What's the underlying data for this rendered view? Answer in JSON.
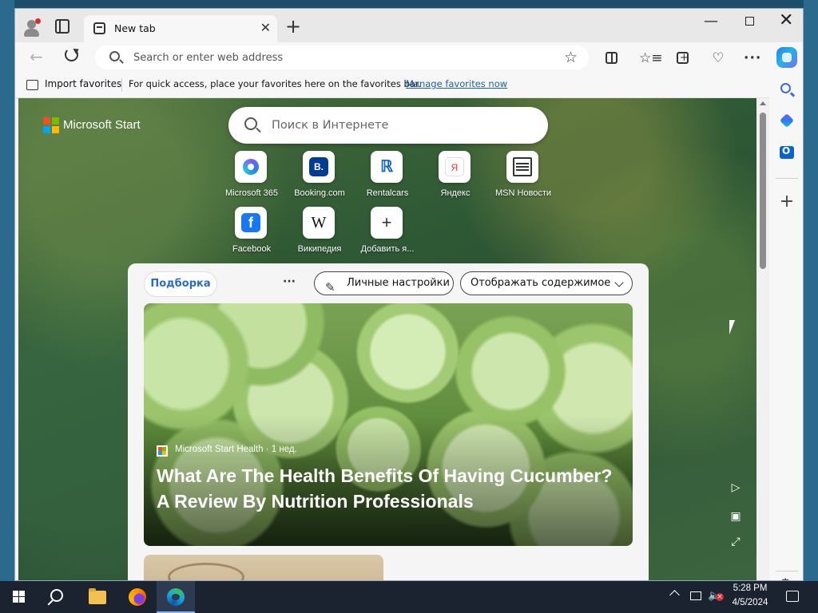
{
  "browser": {
    "tab_title": "New tab",
    "tab_close": "✕",
    "new_tab": "+",
    "address_placeholder": "Search or enter web address",
    "star": "☆",
    "more": "···",
    "favorites_icon": "☆≡",
    "health_icon": "♡"
  },
  "window": {
    "minimize": "—",
    "close": "✕"
  },
  "favbar": {
    "import_label": "Import favorites",
    "tip": "For quick access, place your favorites here on the favorites bar.",
    "manage_link": "Manage favorites now"
  },
  "sidebar": {
    "add": "+",
    "settings": "⚙"
  },
  "newtab": {
    "brand": "Microsoft Start",
    "search_placeholder": "Поиск в Интернете",
    "quick_links": [
      {
        "label": "Microsoft 365",
        "glyph": ""
      },
      {
        "label": "Booking.com",
        "glyph": "B."
      },
      {
        "label": "Rentalcars",
        "glyph": "ℝ"
      },
      {
        "label": "Яндекс",
        "glyph": "Я"
      },
      {
        "label": "MSN Новости",
        "glyph": ""
      },
      {
        "label": "Facebook",
        "glyph": "f"
      },
      {
        "label": "Википедия",
        "glyph": "W"
      },
      {
        "label": "Добавить я...",
        "glyph": "+"
      }
    ]
  },
  "feed": {
    "tab_label": "Подборка",
    "more": "···",
    "personalize_icon": "✎",
    "personalize_label": "Личные настройки",
    "display_label": "Отображать содержимое",
    "hero": {
      "source": "Microsoft Start Health · 1 нед.",
      "title": "What Are The Health Benefits Of Having Cucumber? A Review By Nutrition Professionals"
    }
  },
  "page_controls": {
    "play": "▷",
    "image": "▣",
    "expand": "⤢"
  },
  "taskbar": {
    "time": "5:28 PM",
    "date": "4/5/2024"
  },
  "icons": {
    "profile": "profile-icon",
    "tab_actions": "tab-actions-icon",
    "back": "arrow-left-icon",
    "refresh": "refresh-icon",
    "search": "search-icon",
    "copilot": "copilot-icon",
    "outlook": "outlook-icon"
  },
  "colors": {
    "accent": "#2a6bc9",
    "link": "#1b5fb0",
    "taskbar": "#1b2230"
  }
}
